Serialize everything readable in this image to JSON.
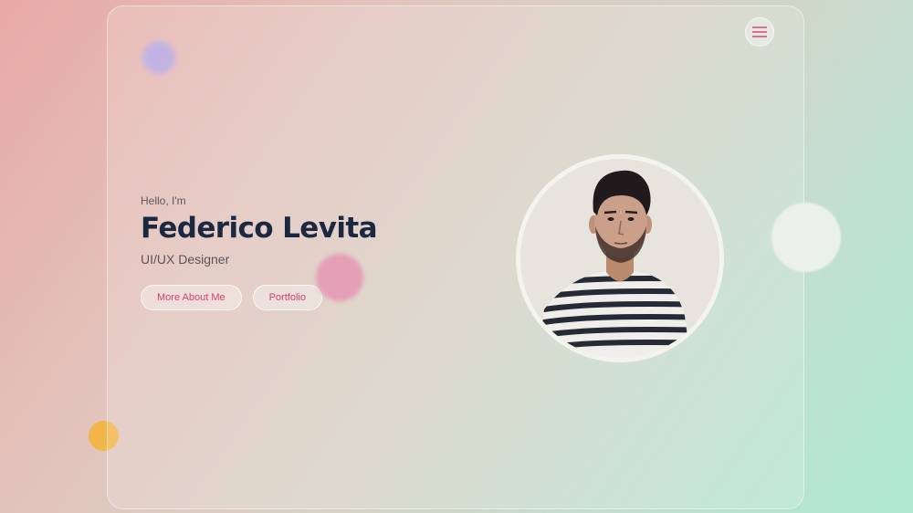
{
  "menu": {
    "icon": "hamburger-menu-icon"
  },
  "hero": {
    "greeting": "Hello, I'm",
    "name": "Federico Levita",
    "role": "UI/UX Designer",
    "buttons": [
      {
        "label": "More About Me"
      },
      {
        "label": "Portfolio"
      }
    ]
  },
  "colors": {
    "accent": "#d53d73",
    "heading": "#1c2840",
    "text": "#59545a"
  }
}
